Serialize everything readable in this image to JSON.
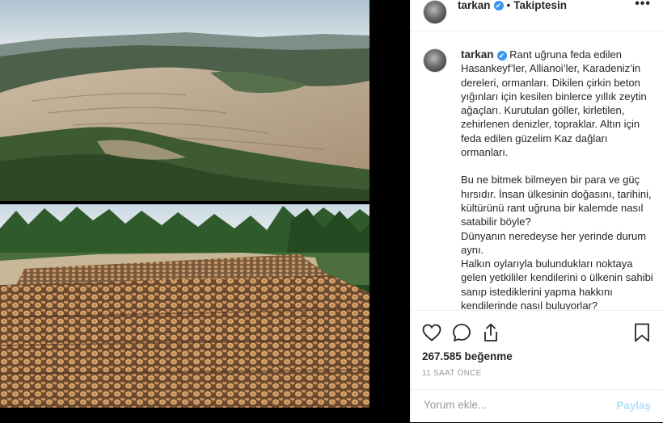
{
  "post": {
    "username": "tarkan",
    "separator": "•",
    "follow_status": "Takiptesin",
    "more": "•••",
    "caption": {
      "paragraphs": [
        "Rant uğruna feda edilen Hasankeyf’ler, Allianoi’ler, Karadeniz’in dereleri, ormanları. Dikilen çirkin beton yığınları için kesilen binlerce yıllık zeytin ağaçları. Kurutulan göller, kirletilen, zehirlenen denizler, topraklar. Altın için feda edilen güzelim Kaz dağları ormanları.",
        "Bu ne bitmek bilmeyen bir para ve güç hırsıdır. İnsan ülkesinin doğasını, tarihini, kültürünü rant uğruna bir kalemde nasıl satabilir böyle?\nDünyanın neredeyse her yerinde durum aynı.\nHalkın oylarıyla bulundukları noktaya gelen yetkililer kendilerini o ülkenin sahibi sanıp istediklerini yapma hakkını kendilerinde nasıl buluyorlar?\nVatandaş kendi toprağını, doğasını"
      ]
    },
    "likes": "267.585 beğenme",
    "time": "11 SAAT ÖNCE",
    "comment_placeholder": "Yorum ekle...",
    "post_label": "Paylaş",
    "icons": {
      "verified": "verified-badge-icon",
      "like": "heart-icon",
      "comment": "comment-icon",
      "share": "share-icon",
      "save": "bookmark-icon"
    },
    "colors": {
      "verified": "#3897f0",
      "post_button_disabled": "#b2dffc",
      "text": "#262626",
      "muted": "#999999"
    }
  }
}
